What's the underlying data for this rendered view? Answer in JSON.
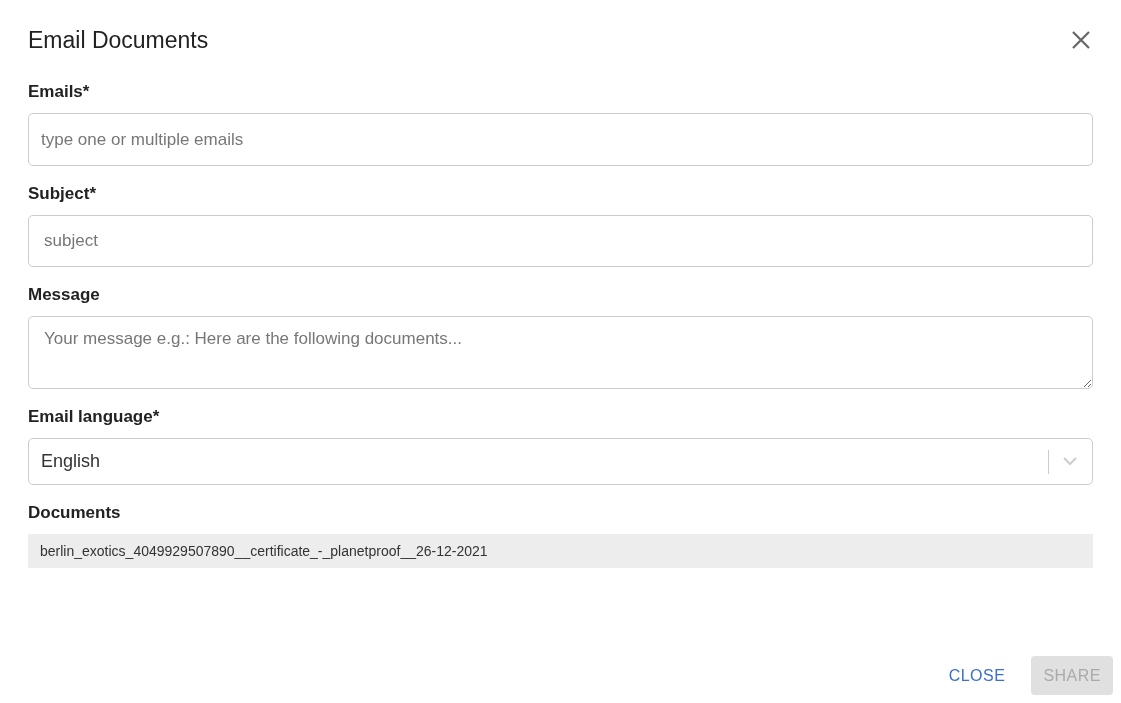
{
  "dialog": {
    "title": "Email Documents"
  },
  "fields": [
    {
      "kind": "input",
      "label": "Emails*",
      "placeholder": "type one or multiple emails"
    },
    {
      "kind": "input",
      "label": "Subject*",
      "placeholder": "subject"
    },
    {
      "kind": "textarea",
      "label": "Message",
      "placeholder": "Your message e.g.: Here are the following documents..."
    },
    {
      "kind": "select",
      "label": "Email language*",
      "value": "English"
    }
  ],
  "documents": {
    "label": "Documents",
    "items": [
      "berlin_exotics_4049929507890__certificate_-_planetproof__26-12-2021"
    ]
  },
  "buttons": [
    {
      "label": "CLOSE",
      "kind": "text",
      "disabled": false
    },
    {
      "label": "SHARE",
      "kind": "contained",
      "disabled": true
    }
  ]
}
